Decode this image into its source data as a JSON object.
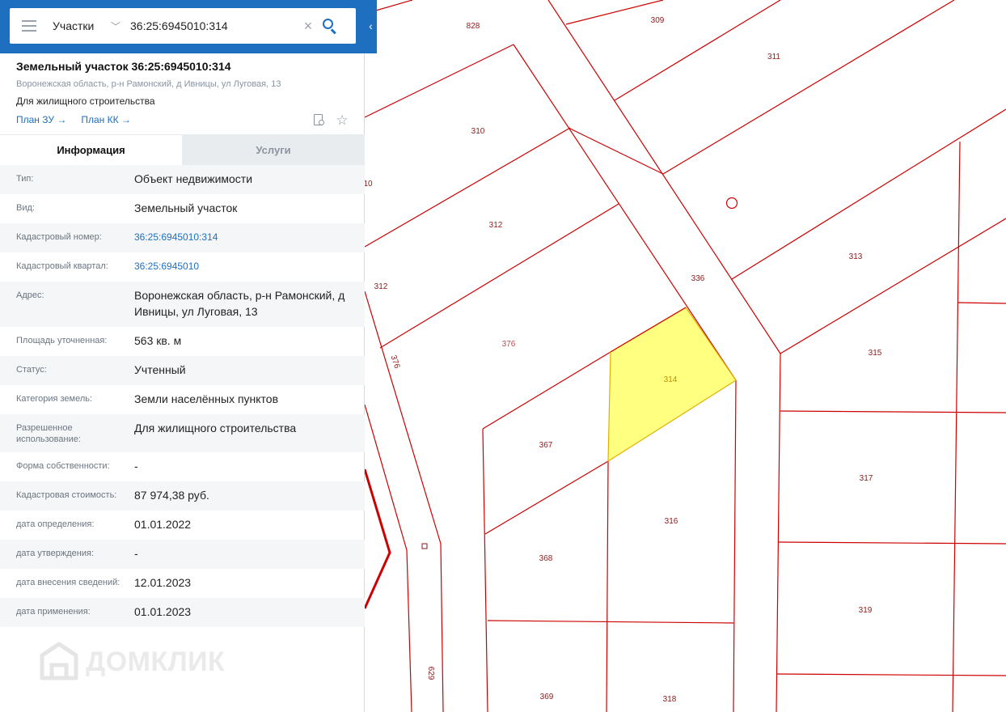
{
  "search": {
    "layer": "Участки",
    "query": "36:25:6945010:314"
  },
  "plot": {
    "title": "Земельный участок 36:25:6945010:314",
    "address": "Воронежская область, р-н Рамонский, д Ивницы, ул Луговая, 13",
    "purpose": "Для жилищного строительства",
    "plan_zu": "План ЗУ →",
    "plan_kk": "План КК →"
  },
  "tabs": {
    "info": "Информация",
    "services": "Услуги"
  },
  "info_rows": [
    {
      "label": "Тип:",
      "value": "Объект недвижимости",
      "link": false
    },
    {
      "label": "Вид:",
      "value": "Земельный участок",
      "link": false
    },
    {
      "label": "Кадастровый номер:",
      "value": "36:25:6945010:314",
      "link": true
    },
    {
      "label": "Кадастровый квартал:",
      "value": "36:25:6945010",
      "link": true
    },
    {
      "label": "Адрес:",
      "value": "Воронежская область, р-н Рамонский, д Ивницы, ул Луговая, 13",
      "link": false
    },
    {
      "label": "Площадь уточненная:",
      "value": "563 кв. м",
      "link": false
    },
    {
      "label": "Статус:",
      "value": "Учтенный",
      "link": false
    },
    {
      "label": "Категория земель:",
      "value": "Земли населённых пунктов",
      "link": false
    },
    {
      "label": "Разрешенное использование:",
      "value": "Для жилищного строительства",
      "link": false
    },
    {
      "label": "Форма собственности:",
      "value": "-",
      "link": false
    },
    {
      "label": "Кадастровая стоимость:",
      "value": "87 974,38 руб.",
      "link": false
    },
    {
      "label": "дата определения:",
      "value": "01.01.2022",
      "link": false
    },
    {
      "label": "дата утверждения:",
      "value": "-",
      "link": false
    },
    {
      "label": "дата внесения сведений:",
      "value": "12.01.2023",
      "link": false
    },
    {
      "label": "дата применения:",
      "value": "01.01.2023",
      "link": false
    }
  ],
  "watermark": "ДОМКЛИК",
  "map": {
    "boundary_color": "#cc0000",
    "highlight_fill": "#ffff80",
    "highlight_stroke": "#e0b000",
    "plot_labels": [
      "828",
      "309",
      "311",
      "310",
      "10",
      "312",
      "312",
      "313",
      "336",
      "376",
      "376",
      "315",
      "314",
      "367",
      "317",
      "316",
      "368",
      "319",
      "369",
      "318",
      "629",
      "o"
    ]
  }
}
